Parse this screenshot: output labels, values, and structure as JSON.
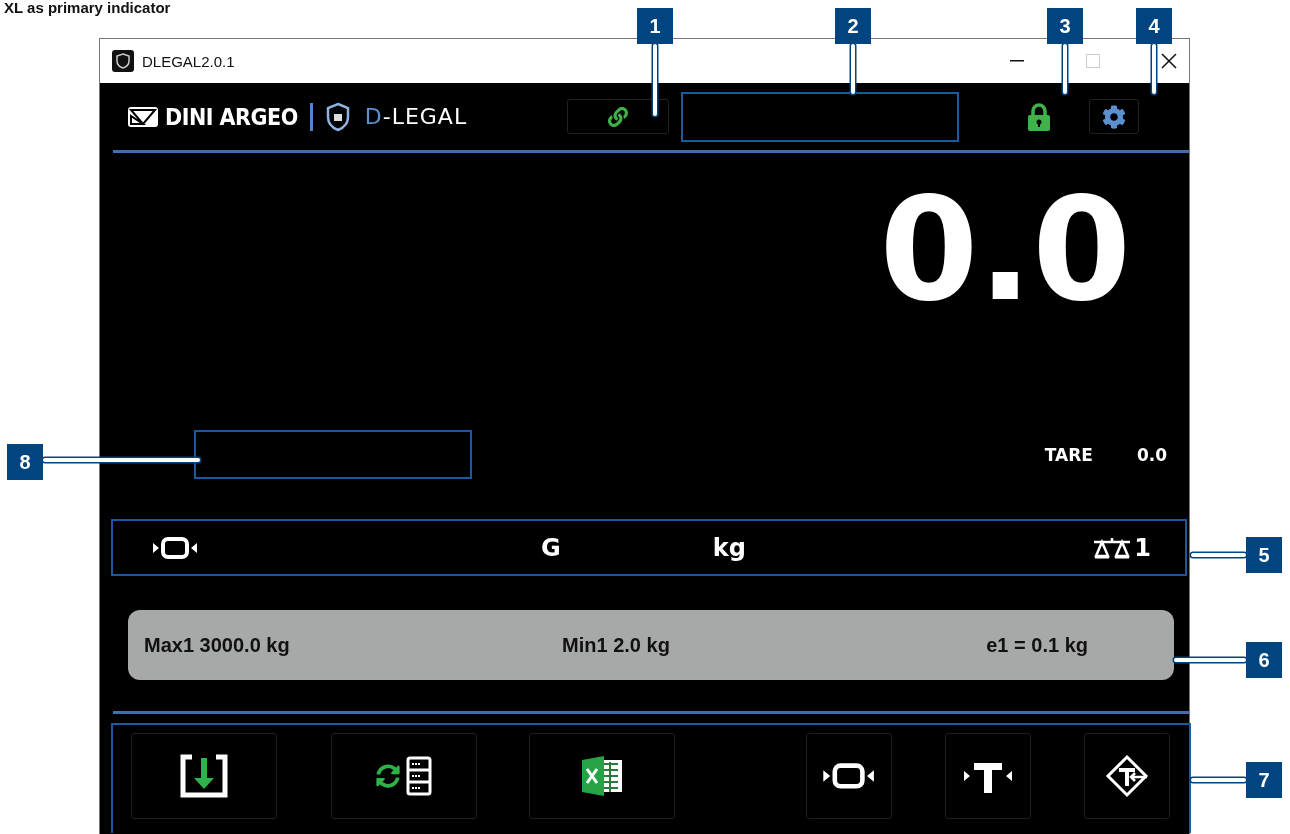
{
  "caption": "XL as primary indicator",
  "window": {
    "title": "DLEGAL2.0.1"
  },
  "header": {
    "brand": "DINI ARGEO",
    "product": "D-LEGAL"
  },
  "weight": {
    "value": "0.0"
  },
  "tare": {
    "label": "TARE",
    "value": "0.0"
  },
  "status": {
    "mode": "G",
    "unit": "kg",
    "scale": "1"
  },
  "info": [
    "Max1 3000.0 kg",
    "Min1 2.0 kg",
    "e1 = 0.1 kg"
  ],
  "toolbar": [
    {
      "kind": "download"
    },
    {
      "kind": "sync"
    },
    {
      "kind": "excel"
    },
    {
      "kind": "zero"
    },
    {
      "kind": "tare"
    },
    {
      "kind": "preset-tare"
    }
  ],
  "callouts": [
    {
      "number": "1"
    },
    {
      "number": "2"
    },
    {
      "number": "3"
    },
    {
      "number": "4"
    },
    {
      "number": "5"
    },
    {
      "number": "6"
    },
    {
      "number": "7"
    },
    {
      "number": "8"
    }
  ]
}
